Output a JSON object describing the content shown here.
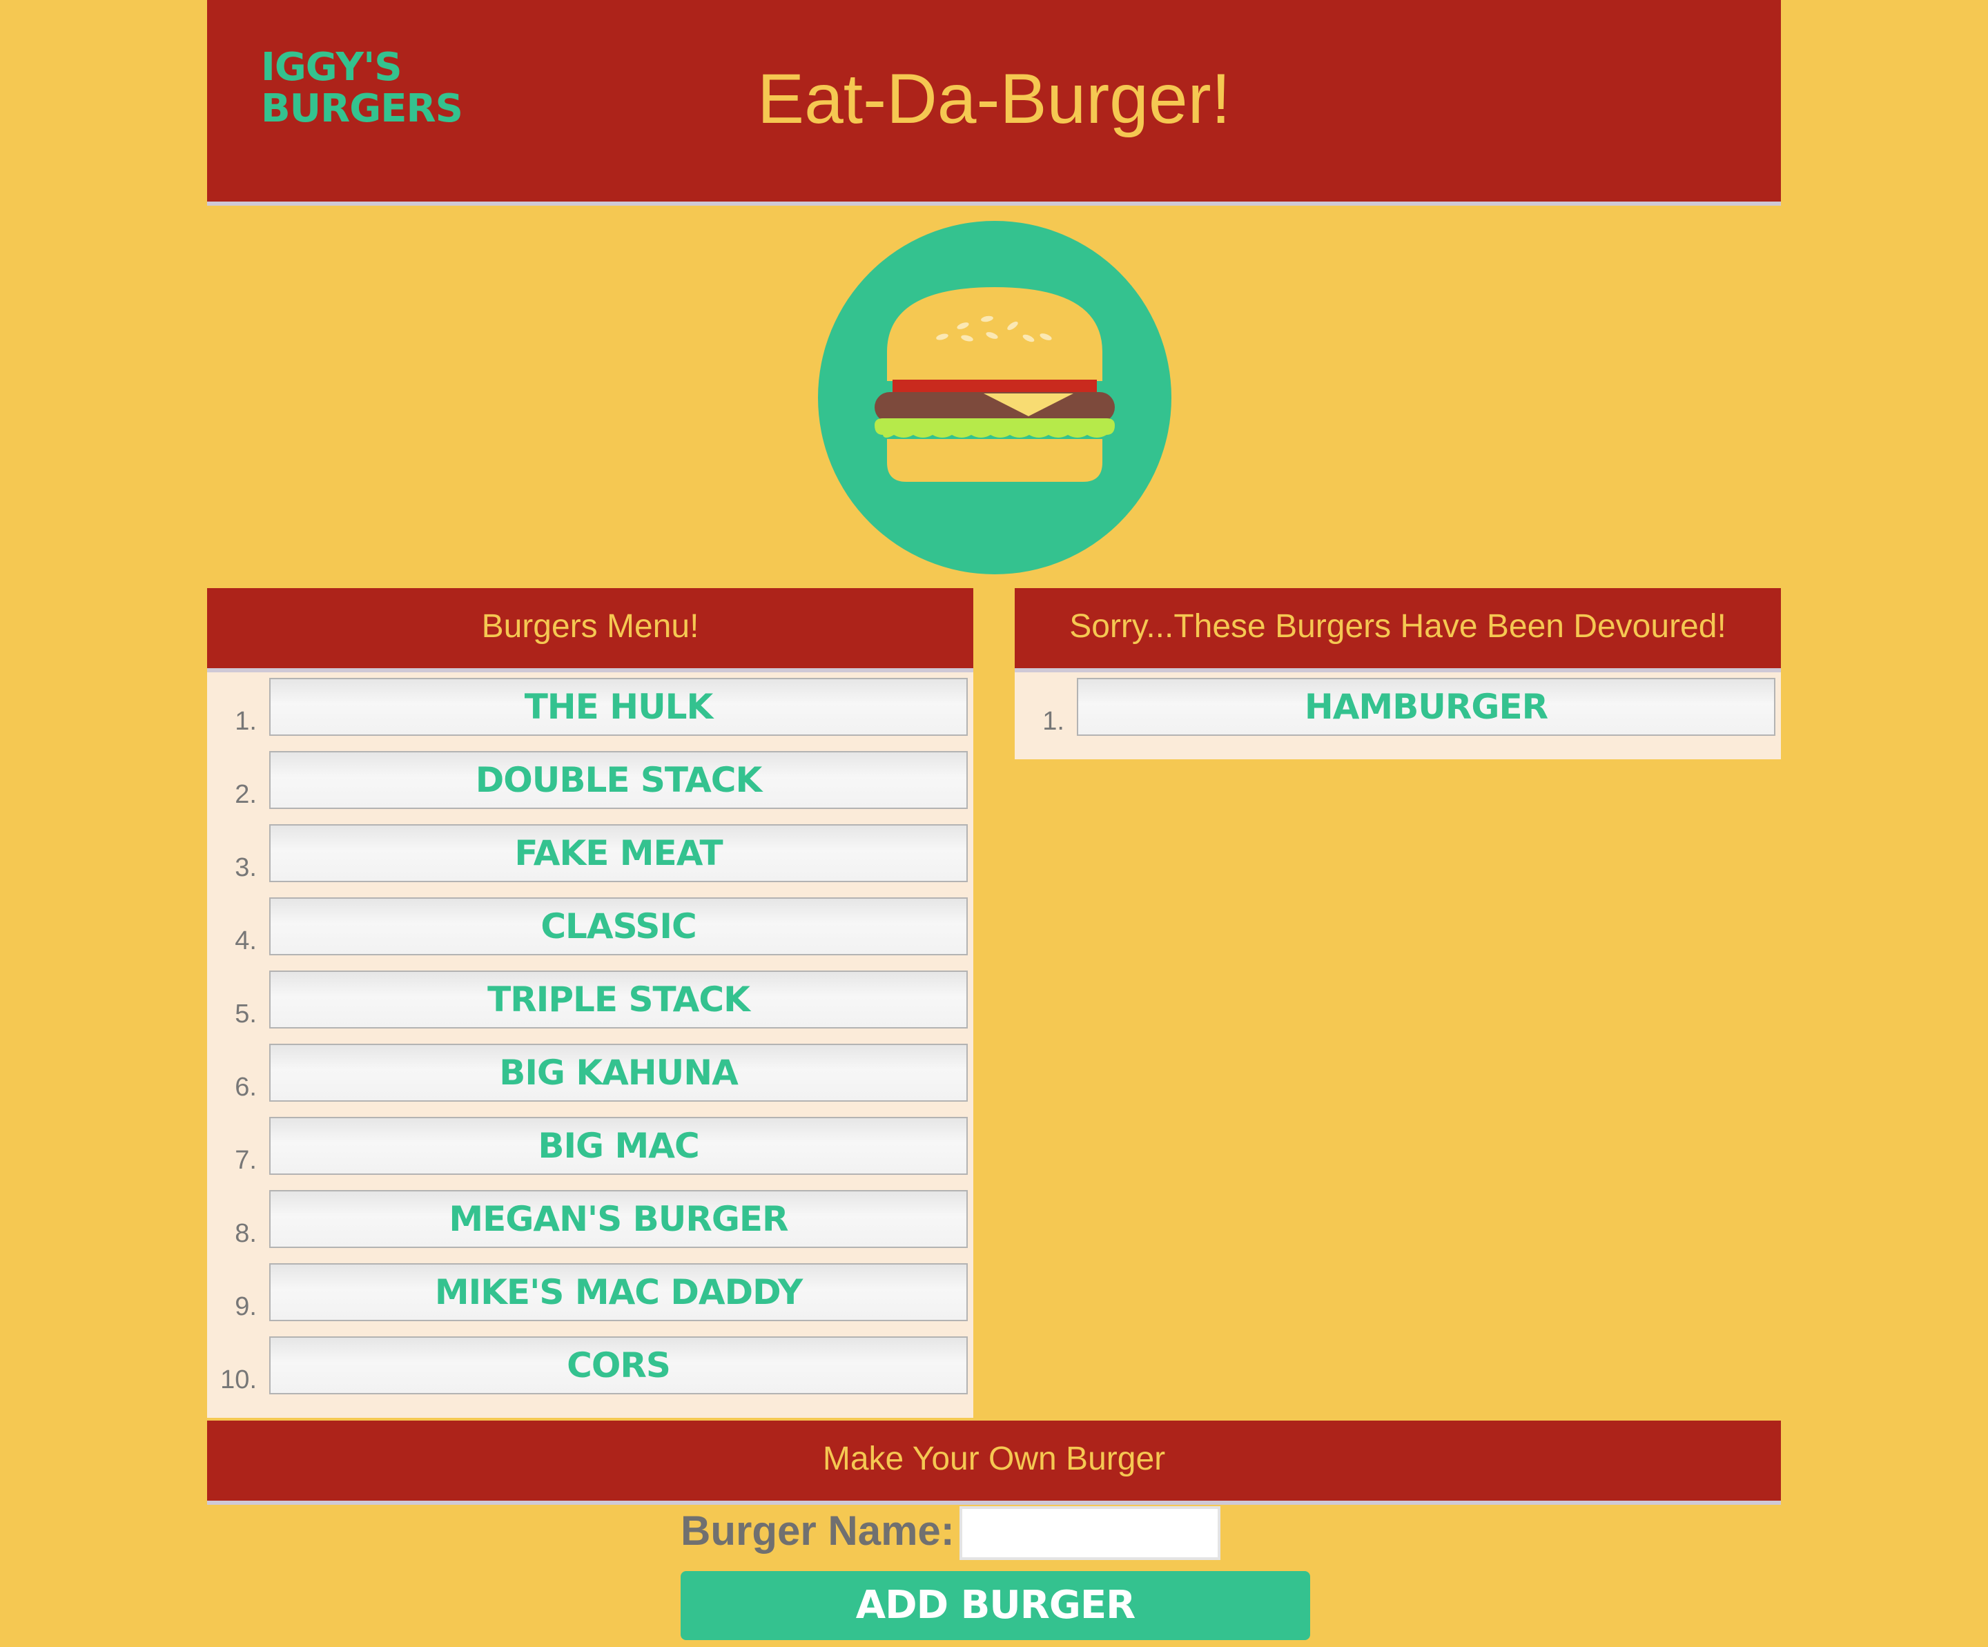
{
  "header": {
    "brand": "Iggy's\nBurgers",
    "title": "Eat-Da-Burger!"
  },
  "menu": {
    "heading": "Burgers Menu!",
    "items": [
      {
        "num": "1.",
        "name": "The Hulk"
      },
      {
        "num": "2.",
        "name": "Double Stack"
      },
      {
        "num": "3.",
        "name": "Fake Meat"
      },
      {
        "num": "4.",
        "name": "Classic"
      },
      {
        "num": "5.",
        "name": "Triple Stack"
      },
      {
        "num": "6.",
        "name": "Big Kahuna"
      },
      {
        "num": "7.",
        "name": "Big Mac"
      },
      {
        "num": "8.",
        "name": "Megan's Burger"
      },
      {
        "num": "9.",
        "name": "Mike's Mac Daddy"
      },
      {
        "num": "10.",
        "name": "CORS"
      }
    ]
  },
  "devoured": {
    "heading": "Sorry...These Burgers Have Been Devoured!",
    "items": [
      {
        "num": "1.",
        "name": "Hamburger"
      }
    ]
  },
  "form": {
    "heading": "Make Your Own Burger",
    "label": "Burger Name:",
    "value": "",
    "button": "Add Burger"
  },
  "colors": {
    "background": "#f5c852",
    "header_red": "#ad231a",
    "accent_green": "#34c28f"
  }
}
